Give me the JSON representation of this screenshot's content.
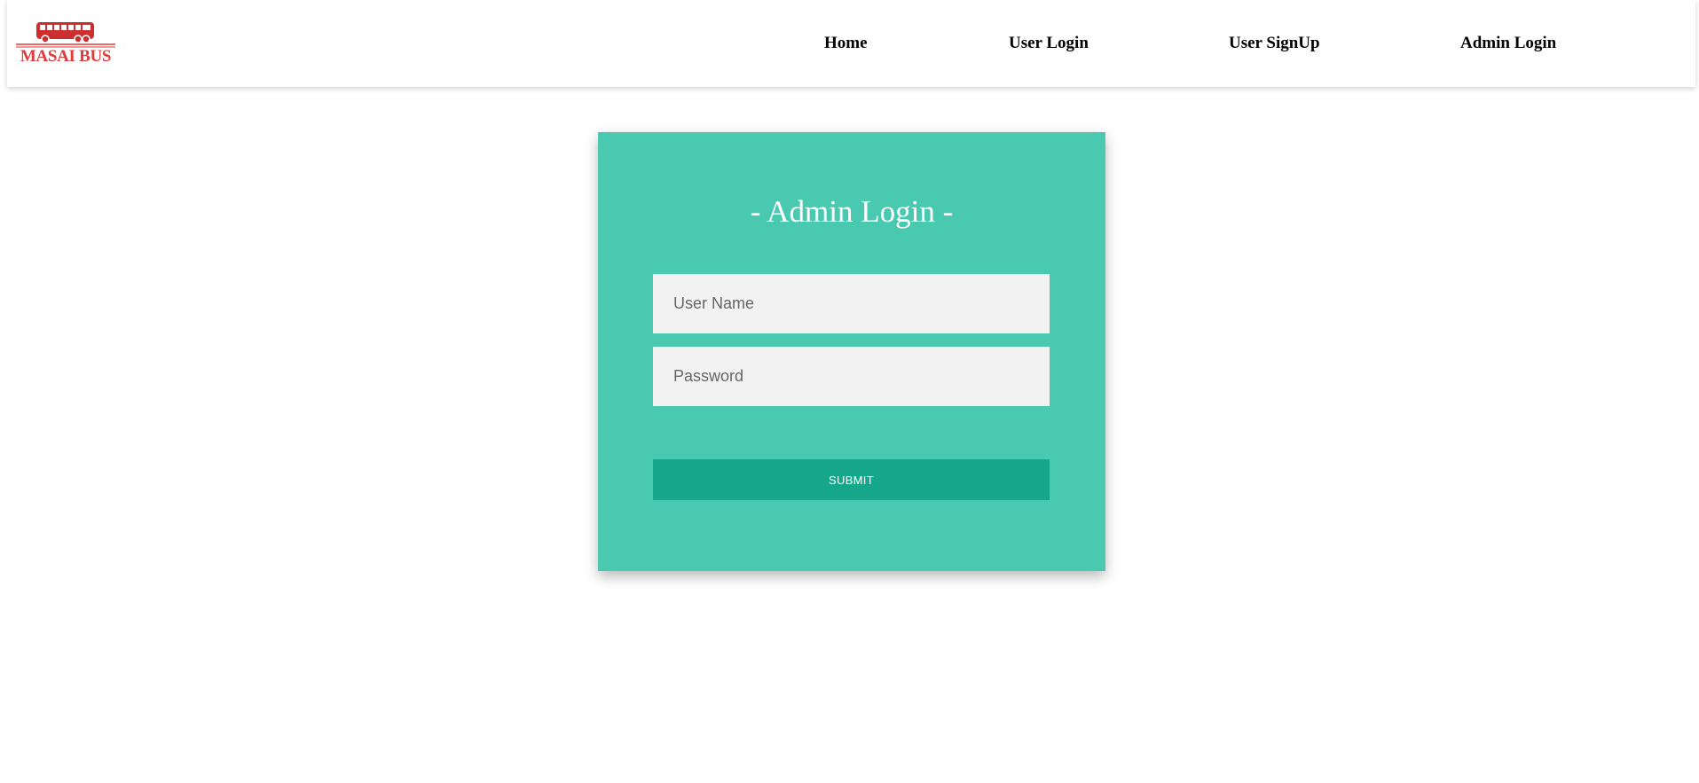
{
  "brand": {
    "name": "MASAI BUS",
    "icon": "bus-icon",
    "color": "#e03a3a"
  },
  "nav": {
    "items": [
      {
        "label": "Home"
      },
      {
        "label": "User Login"
      },
      {
        "label": "User SignUp"
      },
      {
        "label": "Admin Login"
      }
    ]
  },
  "login": {
    "title": "- Admin Login -",
    "username_placeholder": "User Name",
    "password_placeholder": "Password",
    "submit_label": "SUBMIT",
    "card_color": "#48c9b0",
    "button_color": "#16a689"
  }
}
